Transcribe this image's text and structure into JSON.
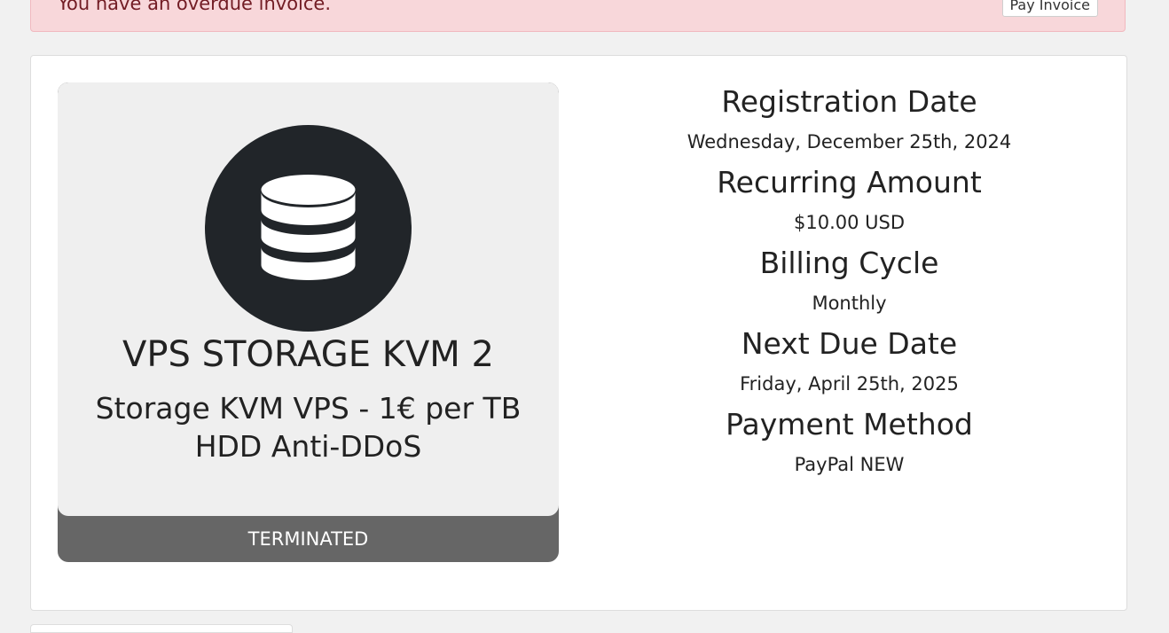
{
  "alert": {
    "message": "You have an overdue invoice.",
    "button_label": "Pay Invoice"
  },
  "product": {
    "icon": "database-icon",
    "name": "VPS STORAGE KVM 2",
    "description": "Storage KVM VPS - 1€ per TB HDD Anti-DDoS",
    "status": "TERMINATED"
  },
  "details": {
    "registration_date_label": "Registration Date",
    "registration_date_value": "Wednesday, December 25th, 2024",
    "recurring_amount_label": "Recurring Amount",
    "recurring_amount_value": "$10.00 USD",
    "billing_cycle_label": "Billing Cycle",
    "billing_cycle_value": "Monthly",
    "next_due_date_label": "Next Due Date",
    "next_due_date_value": "Friday, April 25th, 2025",
    "payment_method_label": "Payment Method",
    "payment_method_value": "PayPal NEW"
  },
  "colors": {
    "alert_bg": "#f8d7da",
    "alert_text": "#721c24",
    "icon_circle": "#212529",
    "status_bar": "#666666"
  }
}
